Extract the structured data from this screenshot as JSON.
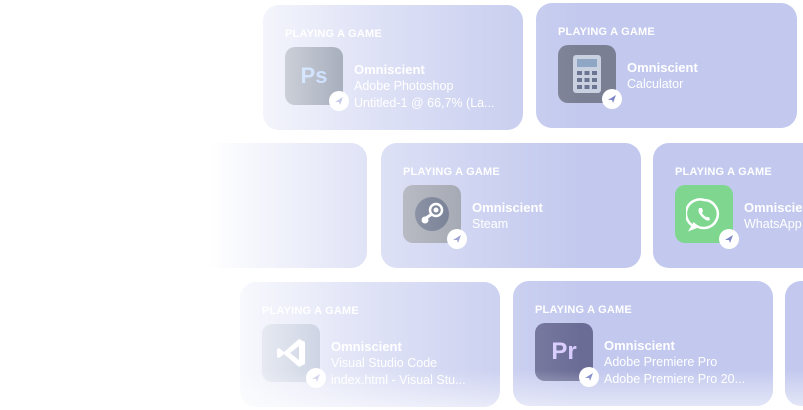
{
  "colors": {
    "card_bg": "#c3c9ee",
    "text": "#ffffff",
    "page_bg": "#ffffff"
  },
  "cards": [
    {
      "heading": "PLAYING A GAME",
      "user": "Omniscient",
      "app": "Adobe Photoshop",
      "detail": "Untitled-1 @ 66,7% (La...",
      "icon": "photoshop-icon"
    },
    {
      "heading": "PLAYING A GAME",
      "user": "Omniscient",
      "app": "Calculator",
      "detail": "",
      "icon": "calculator-icon"
    },
    {
      "heading": "",
      "user": "",
      "app": "",
      "detail": "",
      "icon": ""
    },
    {
      "heading": "PLAYING A GAME",
      "user": "Omniscient",
      "app": "Steam",
      "detail": "",
      "icon": "steam-icon"
    },
    {
      "heading": "PLAYING A GAME",
      "user": "Omniscient",
      "app": "WhatsApp",
      "detail": "",
      "icon": "whatsapp-icon"
    },
    {
      "heading": "PLAYING A GAME",
      "user": "Omniscient",
      "app": "Visual Studio Code",
      "detail": "index.html - Visual Stu...",
      "icon": "vscode-icon"
    },
    {
      "heading": "PLAYING A GAME",
      "user": "Omniscient",
      "app": "Adobe Premiere Pro",
      "detail": "Adobe Premiere Pro 20...",
      "icon": "premiere-icon"
    }
  ]
}
